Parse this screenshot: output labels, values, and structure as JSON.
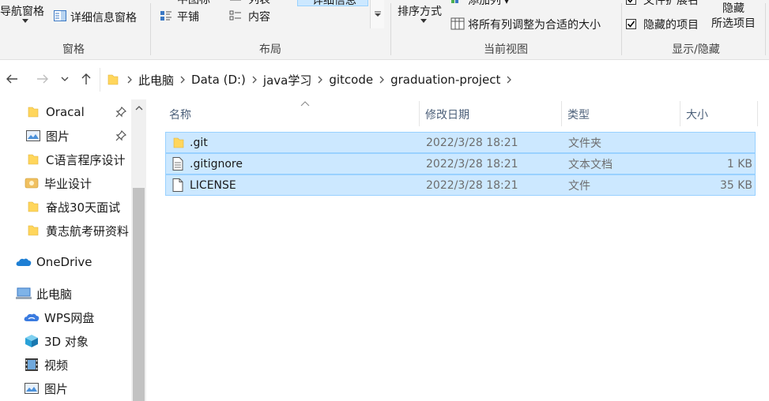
{
  "ribbon": {
    "pane_group": {
      "nav_pane_label": "导航窗格",
      "details_pane_label": "详细信息窗格",
      "group_label": "窗格"
    },
    "layout_group": {
      "items": [
        "平铺",
        "内容"
      ],
      "top_partial": [
        "中图标",
        "列表",
        "详细信息"
      ],
      "group_label": "布局"
    },
    "current_view_group": {
      "sort_label": "排序方式",
      "add_column_label": "添加列",
      "fit_columns_label": "将所有列调整为合适的大小",
      "group_label": "当前视图"
    },
    "show_hide_group": {
      "ext_label": "文件扩展名",
      "hidden_items_label": "隐藏的项目",
      "hide_selected_line1": "隐藏",
      "hide_selected_line2": "所选项目",
      "group_label": "显示/隐藏"
    }
  },
  "address": {
    "crumbs": [
      "此电脑",
      "Data (D:)",
      "java学习",
      "gitcode",
      "graduation-project"
    ]
  },
  "nav": {
    "items": [
      {
        "label": "Oracal",
        "icon": "folder-icon",
        "pinned": true
      },
      {
        "label": "图片",
        "icon": "pictures-icon",
        "pinned": true
      },
      {
        "label": "C语言程序设计",
        "icon": "folder-icon",
        "pinned": false
      },
      {
        "label": "毕业设计",
        "icon": "folder-special-icon",
        "pinned": false
      },
      {
        "label": "奋战30天面试",
        "icon": "folder-icon",
        "pinned": false
      },
      {
        "label": "黄志航考研资料",
        "icon": "folder-icon",
        "pinned": false
      },
      {
        "label": "OneDrive",
        "icon": "onedrive-icon",
        "pinned": false
      },
      {
        "label": "此电脑",
        "icon": "this-pc-icon",
        "pinned": false
      },
      {
        "label": "WPS网盘",
        "icon": "wps-cloud-icon",
        "pinned": false
      },
      {
        "label": "3D 对象",
        "icon": "3d-objects-icon",
        "pinned": false
      },
      {
        "label": "视频",
        "icon": "videos-icon",
        "pinned": false
      },
      {
        "label": "图片",
        "icon": "pictures-icon",
        "pinned": false
      }
    ]
  },
  "columns": {
    "name": "名称",
    "modified": "修改日期",
    "type": "类型",
    "size": "大小"
  },
  "files": [
    {
      "name": ".git",
      "modified": "2022/3/28 18:21",
      "type": "文件夹",
      "size": "",
      "icon": "folder-icon"
    },
    {
      "name": ".gitignore",
      "modified": "2022/3/28 18:21",
      "type": "文本文档",
      "size": "1 KB",
      "icon": "text-file-icon"
    },
    {
      "name": "LICENSE",
      "modified": "2022/3/28 18:21",
      "type": "文件",
      "size": "35 KB",
      "icon": "file-icon"
    }
  ],
  "colors": {
    "selection_bg": "#cce8ff",
    "selection_border": "#99d1ff",
    "folder": "#ffd65c",
    "header_text": "#4c607a"
  }
}
